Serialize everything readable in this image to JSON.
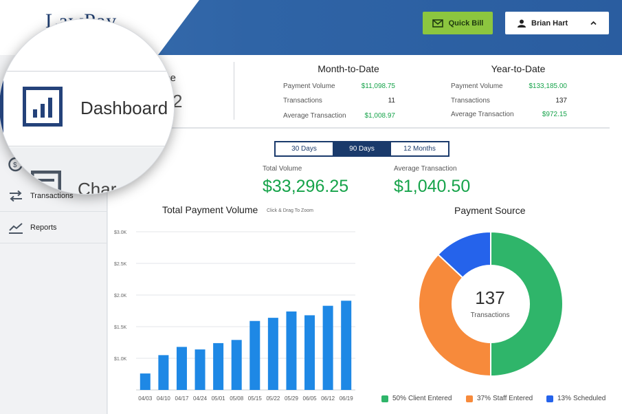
{
  "header": {
    "logo_text": "LawPay",
    "quick_bill_label": "Quick Bill",
    "user_name": "Brian Hart"
  },
  "sidebar": {
    "items": [
      {
        "label": "Transactions",
        "icon": "arrows-exchange-icon"
      },
      {
        "label": "Reports",
        "icon": "line-chart-icon"
      }
    ]
  },
  "magnifier": {
    "label": "Dashboard",
    "partial_label": "Char"
  },
  "stats": {
    "partial_title": "une",
    "partial_value": "2",
    "month_to_date": {
      "title": "Month-to-Date",
      "rows": [
        {
          "label": "Payment Volume",
          "value": "$11,098.75"
        },
        {
          "label": "Transactions",
          "value": "11"
        },
        {
          "label": "Average Transaction",
          "value": "$1,008.97"
        }
      ]
    },
    "year_to_date": {
      "title": "Year-to-Date",
      "rows": [
        {
          "label": "Payment Volume",
          "value": "$133,185.00"
        },
        {
          "label": "Transactions",
          "value": "137"
        },
        {
          "label": "Average Transaction",
          "value": "$972.15"
        }
      ]
    }
  },
  "range_tabs": [
    {
      "label": "30 Days",
      "active": false
    },
    {
      "label": "90 Days",
      "active": true
    },
    {
      "label": "12 Months",
      "active": false
    }
  ],
  "kpis": {
    "total_volume_label": "Total Volume",
    "total_volume_value": "$33,296.25",
    "avg_transaction_label": "Average Transaction",
    "avg_transaction_value": "$1,040.50"
  },
  "colors": {
    "brand_blue": "#2f64a6",
    "green": "#16a34a",
    "bar_blue": "#1e88e5",
    "donut_green": "#2fb56a",
    "donut_orange": "#f78a3b",
    "donut_blue": "#2563eb"
  },
  "chart_data": [
    {
      "type": "bar",
      "title": "Total Payment Volume",
      "subtitle": "Click & Drag To Zoom",
      "categories": [
        "04/03",
        "04/10",
        "04/17",
        "04/24",
        "05/01",
        "05/08",
        "05/15",
        "05/22",
        "05/29",
        "06/05",
        "06/12",
        "06/19"
      ],
      "values": [
        760,
        1050,
        1180,
        1140,
        1240,
        1290,
        1590,
        1640,
        1740,
        1680,
        1830,
        1910
      ],
      "y_ticks": [
        "$1.0K",
        "$1.5K",
        "$2.0K",
        "$2.5K",
        "$3.0K"
      ],
      "ylim": [
        500,
        3000
      ]
    },
    {
      "type": "pie",
      "title": "Payment Source",
      "center_value": "137",
      "center_label": "Transactions",
      "slices": [
        {
          "label": "Client Entered",
          "percent": 50,
          "display": "50%",
          "color": "#2fb56a"
        },
        {
          "label": "Staff Entered",
          "percent": 37,
          "display": "37%",
          "color": "#f78a3b"
        },
        {
          "label": "Scheduled",
          "percent": 13,
          "display": "13%",
          "color": "#2563eb"
        }
      ]
    }
  ]
}
